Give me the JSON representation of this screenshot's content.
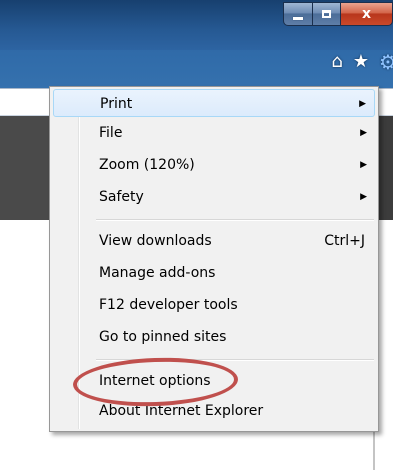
{
  "window": {
    "minimize_glyph": "",
    "maximize_glyph": "",
    "close_label": "x"
  },
  "toolbar": {
    "home_glyph": "⌂",
    "favorites_glyph": "★",
    "tools_glyph": "⚙"
  },
  "menu": {
    "items": [
      {
        "label": "Print",
        "has_submenu": true,
        "shortcut": ""
      },
      {
        "label": "File",
        "has_submenu": true,
        "shortcut": ""
      },
      {
        "label": "Zoom (120%)",
        "has_submenu": true,
        "shortcut": ""
      },
      {
        "label": "Safety",
        "has_submenu": true,
        "shortcut": ""
      },
      {
        "label": "View downloads",
        "has_submenu": false,
        "shortcut": "Ctrl+J"
      },
      {
        "label": "Manage add-ons",
        "has_submenu": false,
        "shortcut": ""
      },
      {
        "label": "F12 developer tools",
        "has_submenu": false,
        "shortcut": ""
      },
      {
        "label": "Go to pinned sites",
        "has_submenu": false,
        "shortcut": ""
      },
      {
        "label": "Internet options",
        "has_submenu": false,
        "shortcut": ""
      },
      {
        "label": "About Internet Explorer",
        "has_submenu": false,
        "shortcut": ""
      }
    ],
    "submenu_arrow": "▶"
  },
  "colors": {
    "annotation": "#c0504d",
    "highlight": "#dcebfc",
    "close_button": "#c9492a"
  }
}
